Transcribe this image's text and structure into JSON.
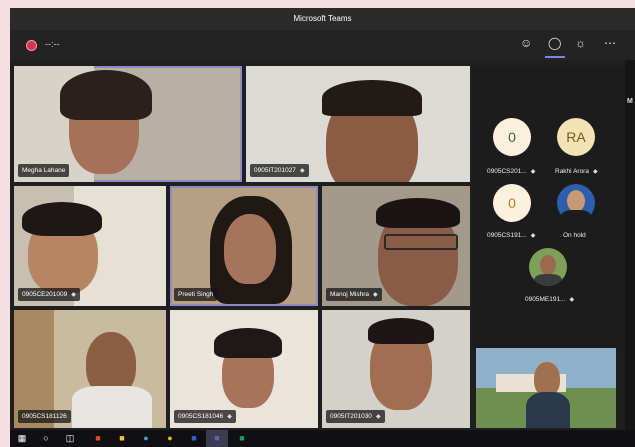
{
  "window": {
    "title": "Microsoft Teams"
  },
  "call": {
    "timer": "--:--",
    "icons": [
      "participants-icon",
      "chat-icon",
      "reactions-icon",
      "more-icon"
    ]
  },
  "tiles": [
    {
      "name": "Megha Lahane"
    },
    {
      "name": "0905IT201027"
    },
    {
      "name": "0905CE201009"
    },
    {
      "name": "Preeti Singh"
    },
    {
      "name": "Manoj Mishra"
    },
    {
      "name": "0905CS181126"
    },
    {
      "name": "0905CS181046"
    },
    {
      "name": "0905IT201030"
    }
  ],
  "roster": [
    {
      "initials": "0",
      "label": "0905CS201..."
    },
    {
      "initials": "RA",
      "label": "Rakhi Arora"
    },
    {
      "initials": "0",
      "label": "0905CS191..."
    },
    {
      "initials": "",
      "label": "On hold"
    },
    {
      "initials": "",
      "label": "0905ME191..."
    }
  ],
  "panel_letter": "M",
  "colors": {
    "accent": "#7b83eb",
    "record": "#d4374a",
    "avatar_bg": "#fbf1dc",
    "avatar_ra": "#f3e3b4"
  }
}
